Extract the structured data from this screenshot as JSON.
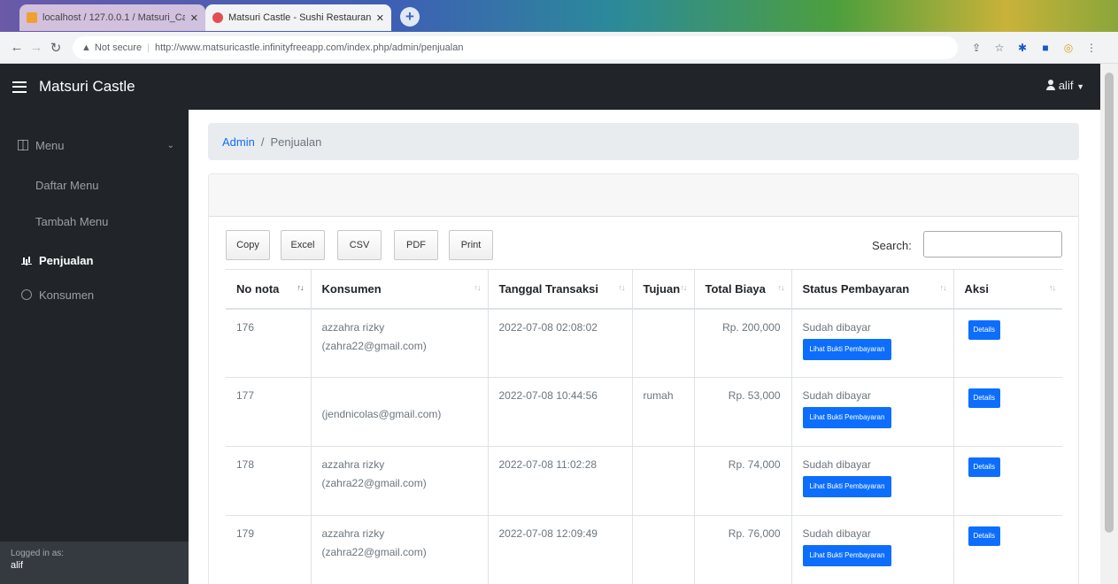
{
  "browser": {
    "tabs": [
      {
        "title": "localhost / 127.0.0.1 / Matsuri_Ca",
        "active": false
      },
      {
        "title": "Matsuri Castle - Sushi Restaurant",
        "active": true
      }
    ],
    "url_security": "Not secure",
    "url": "http://www.matsuricastle.infinityfreeapp.com/index.php/admin/penjualan"
  },
  "navbar": {
    "brand": "Matsuri Castle",
    "user": "alif"
  },
  "sidebar": {
    "menu_label": "Menu",
    "items": [
      {
        "label": "Daftar Menu"
      },
      {
        "label": "Tambah Menu"
      },
      {
        "label": "Penjualan"
      },
      {
        "label": "Konsumen"
      }
    ],
    "footer_label": "Logged in as:",
    "footer_user": "alif"
  },
  "breadcrumb": {
    "root": "Admin",
    "current": "Penjualan"
  },
  "toolbar": {
    "buttons": [
      "Copy",
      "Excel",
      "CSV",
      "PDF",
      "Print"
    ],
    "search_label": "Search:"
  },
  "table": {
    "headers": [
      "No nota",
      "Konsumen",
      "Tanggal Transaksi",
      "Tujuan",
      "Total Biaya",
      "Status Pembayaran",
      "Aksi"
    ],
    "proof_button": "Lihat Bukti Pembayaran",
    "detail_button": "Details",
    "rows": [
      {
        "no": "176",
        "name": "azzahra rizky",
        "email": "(zahra22@gmail.com)",
        "date": "2022-07-08 02:08:02",
        "tujuan": "",
        "total": "Rp. 200,000",
        "status": "Sudah dibayar"
      },
      {
        "no": "177",
        "name": "",
        "email": "(jendnicolas@gmail.com)",
        "date": "2022-07-08 10:44:56",
        "tujuan": "rumah",
        "total": "Rp. 53,000",
        "status": "Sudah dibayar"
      },
      {
        "no": "178",
        "name": "azzahra rizky",
        "email": "(zahra22@gmail.com)",
        "date": "2022-07-08 11:02:28",
        "tujuan": "",
        "total": "Rp. 74,000",
        "status": "Sudah dibayar"
      },
      {
        "no": "179",
        "name": "azzahra rizky",
        "email": "(zahra22@gmail.com)",
        "date": "2022-07-08 12:09:49",
        "tujuan": "",
        "total": "Rp. 76,000",
        "status": "Sudah dibayar"
      }
    ]
  },
  "colors": {
    "navbar": "#212529",
    "primary": "#0d6efd",
    "breadcrumb_bg": "#e9ecef"
  }
}
